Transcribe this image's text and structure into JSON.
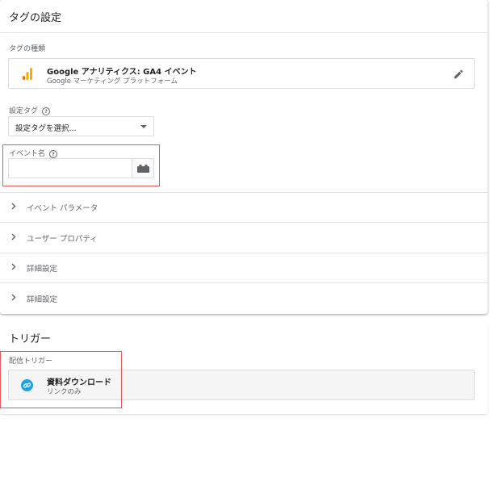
{
  "tag_config": {
    "title": "タグの設定",
    "tag_type_label": "タグの種類",
    "tag_type": {
      "name": "Google アナリティクス: GA4 イベント",
      "subtitle": "Google マーケティング プラットフォーム",
      "icon": "google-analytics-icon"
    },
    "config_tag": {
      "label": "設定タグ",
      "help": "?",
      "selected": "設定タグを選択..."
    },
    "event_name": {
      "label": "イベント名",
      "help": "?",
      "value": "",
      "placeholder": ""
    },
    "sections": [
      {
        "label": "イベント パラメータ"
      },
      {
        "label": "ユーザー プロパティ"
      },
      {
        "label": "詳細設定"
      },
      {
        "label": "詳細設定"
      }
    ]
  },
  "trigger": {
    "title": "トリガー",
    "firing_label": "配信トリガー",
    "item": {
      "name": "資料ダウンロード",
      "subtitle": "リンクのみ",
      "icon": "link-icon",
      "icon_color": "#1ea1e5"
    }
  },
  "colors": {
    "highlight": "#e8585a",
    "ga_orange": "#f9ab00",
    "ga_dark_orange": "#e37400"
  }
}
